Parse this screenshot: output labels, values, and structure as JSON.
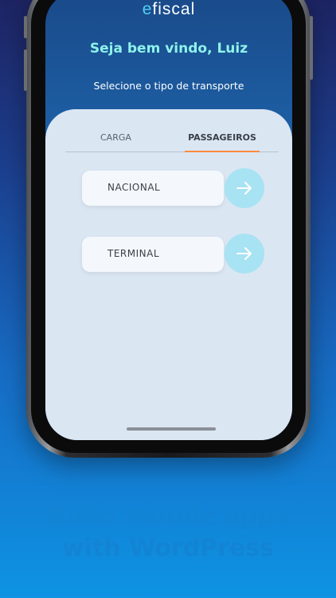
{
  "app": {
    "logo_prefix": "e",
    "logo_rest": "fiscal",
    "welcome": "Seja bem vindo, Luiz",
    "subtitle": "Selecione o tipo de transporte"
  },
  "tabs": [
    {
      "label": "CARGA",
      "active": false
    },
    {
      "label": "PASSAGEIROS",
      "active": true
    }
  ],
  "options": [
    {
      "label": "NACIONAL",
      "icon": "arrow-right-icon"
    },
    {
      "label": "TERMINAL",
      "icon": "arrow-right-icon"
    }
  ],
  "promo": {
    "line1": "Build mobile apps",
    "line2": "with WordPress"
  },
  "colors": {
    "accent_tab": "#ff8a3d",
    "arrow_button": "#a7e3f3",
    "welcome_text": "#8ef2ea",
    "logo_accent": "#4fd0f5"
  }
}
